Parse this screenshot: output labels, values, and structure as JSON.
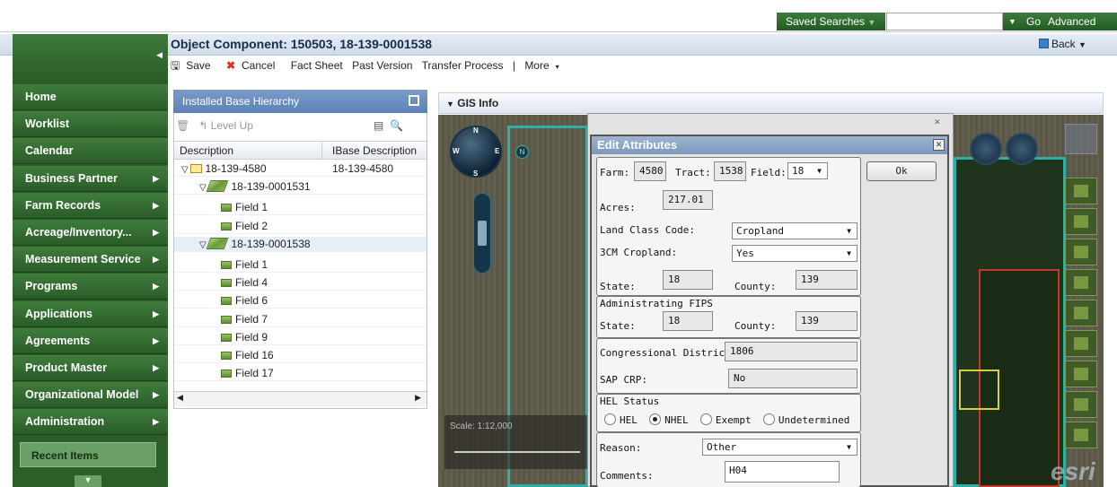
{
  "topbar": {
    "saved_searches": "Saved Searches",
    "go": "Go",
    "advanced": "Advanced"
  },
  "header": {
    "title": "Object Component: 150503, 18-139-0001538",
    "back": "Back"
  },
  "toolbar": {
    "save": "Save",
    "cancel": "Cancel",
    "fact_sheet": "Fact Sheet",
    "past_version": "Past Version",
    "transfer_process": "Transfer Process",
    "more": "More"
  },
  "nav": {
    "items": [
      {
        "label": "Home",
        "arrow": false
      },
      {
        "label": "Worklist",
        "arrow": false
      },
      {
        "label": "Calendar",
        "arrow": false
      },
      {
        "label": "Business Partner",
        "arrow": true
      },
      {
        "label": "Farm Records",
        "arrow": true
      },
      {
        "label": "Acreage/Inventory...",
        "arrow": true
      },
      {
        "label": "Measurement Service",
        "arrow": true
      },
      {
        "label": "Programs",
        "arrow": true
      },
      {
        "label": "Applications",
        "arrow": true
      },
      {
        "label": "Agreements",
        "arrow": true
      },
      {
        "label": "Product Master",
        "arrow": true
      },
      {
        "label": "Organizational Model",
        "arrow": true
      },
      {
        "label": "Administration",
        "arrow": true
      }
    ],
    "recent": "Recent Items"
  },
  "hierarchy": {
    "title": "Installed Base Hierarchy",
    "level_up": "Level Up",
    "col_description": "Description",
    "col_ibase": "IBase Description",
    "rows": [
      {
        "label": "18-139-4580",
        "desc": "18-139-4580",
        "type": "root"
      },
      {
        "label": "18-139-0001531",
        "desc": "",
        "type": "component"
      },
      {
        "label": "Field 1",
        "desc": "",
        "type": "field"
      },
      {
        "label": "Field 2",
        "desc": "",
        "type": "field"
      },
      {
        "label": "18-139-0001538",
        "desc": "",
        "type": "component"
      },
      {
        "label": "Field 1",
        "desc": "",
        "type": "field"
      },
      {
        "label": "Field 4",
        "desc": "",
        "type": "field"
      },
      {
        "label": "Field 6",
        "desc": "",
        "type": "field"
      },
      {
        "label": "Field 7",
        "desc": "",
        "type": "field"
      },
      {
        "label": "Field 9",
        "desc": "",
        "type": "field"
      },
      {
        "label": "Field 16",
        "desc": "",
        "type": "field"
      },
      {
        "label": "Field 17",
        "desc": "",
        "type": "field"
      }
    ]
  },
  "gis": {
    "title": "GIS Info",
    "scale": "Scale: 1:12,000",
    "logo": "esri",
    "compass": {
      "n": "N",
      "s": "S",
      "w": "W",
      "e": "E"
    }
  },
  "dialog": {
    "title": "Edit Attributes",
    "ok": "Ok",
    "farm_label": "Farm:",
    "farm": "4580",
    "tract_label": "Tract:",
    "tract": "1538",
    "field_label": "Field:",
    "field": "18",
    "acres_label": "Acres:",
    "acres": "217.01",
    "land_class_label": "Land Class Code:",
    "land_class": "Cropland",
    "cropland_label": "3CM Cropland:",
    "cropland": "Yes",
    "state_label": "State:",
    "state": "18",
    "county_label": "County:",
    "county": "139",
    "admin_fips_label": "Administrating FIPS",
    "admin_state": "18",
    "admin_county": "139",
    "cong_label": "Congressional District FIPS:",
    "cong": "1806",
    "sap_label": "SAP CRP:",
    "sap": "No",
    "hel_status_label": "HEL Status",
    "hel_options": [
      "HEL",
      "NHEL",
      "Exempt",
      "Undetermined"
    ],
    "hel_selected": "NHEL",
    "reason_label": "Reason:",
    "reason": "Other",
    "comments_label": "Comments:",
    "comments": "H04"
  }
}
